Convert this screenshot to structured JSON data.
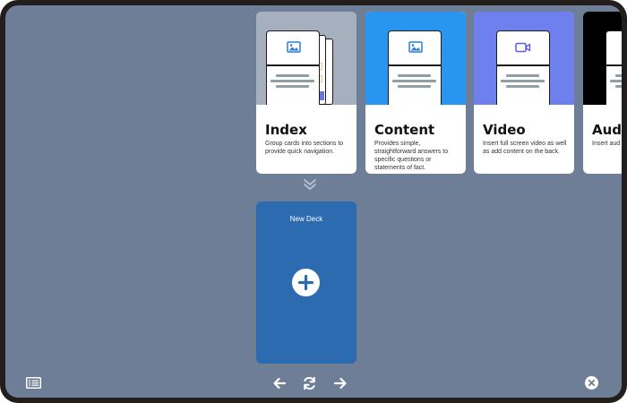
{
  "templates": [
    {
      "title": "Index",
      "description": "Group cards into sections to provide quick navigation.",
      "hero_color": "#a6afbe",
      "icon": "image-icon"
    },
    {
      "title": "Content",
      "description": "Provides simple, straightforward answers to specific questions or statements of fact.",
      "hero_color": "#2896f0",
      "icon": "image-icon"
    },
    {
      "title": "Video",
      "description": "Insert full screen video as well as add content on the back.",
      "hero_color": "#6e80ee",
      "icon": "video-camera-icon"
    },
    {
      "title": "Aud",
      "description": "Insert aud as add con",
      "hero_color": "#000000",
      "icon": "audio-icon"
    }
  ],
  "new_deck": {
    "label": "New Deck",
    "icon": "plus-icon",
    "color": "#2d6bb0"
  },
  "toolbar": {
    "left_icon": "list-view-icon",
    "center_icons": [
      "arrow-left-icon",
      "refresh-icon",
      "arrow-right-icon"
    ],
    "right_icon": "close-circle-icon"
  },
  "colors": {
    "background": "#6e7e97",
    "bezel": "#231e1c",
    "accent": "#2d6bb0"
  }
}
